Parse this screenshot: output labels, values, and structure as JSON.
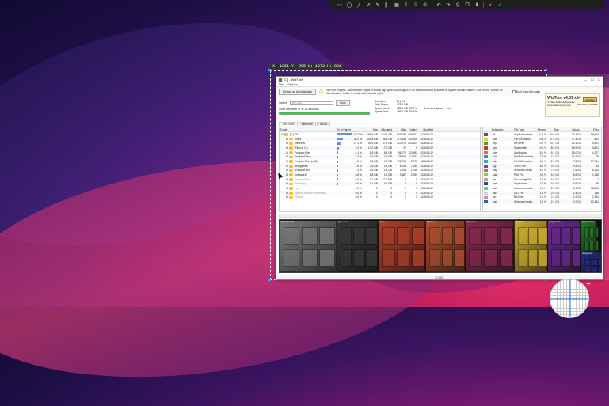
{
  "capture_toolbar": {
    "icons": [
      "rectangle-icon",
      "ellipse-icon",
      "line-icon",
      "arrow-icon",
      "pencil-icon",
      "marker-icon",
      "mosaic-icon",
      "text-icon",
      "sticker-icon",
      "number-icon",
      "undo-icon",
      "redo-icon",
      "pin-icon",
      "copy-icon",
      "save-icon",
      "close-icon",
      "confirm-icon"
    ]
  },
  "selection": {
    "label": "X: 1061 Y: 285 W: 1073 H: 801"
  },
  "window": {
    "title": "[C:] - WizTree",
    "menu": [
      "File",
      "Options"
    ],
    "restart_button": "Restart as Administrator",
    "notice": "WizTree requires \"Administrator\" rights to enable high speed scanning of NTFS hard drives and to access all system files and folders. Click on the \"Restart as Administrator\" button to enable Administrator rights.",
    "dont_show": "Don't show this again",
    "promo": {
      "title": "WizTree v4.31 x64",
      "line1": "© 2026 Antibody Software",
      "line2": "www.diskanalyzer.com",
      "button": "Donate",
      "note": "Click to Go to Donation"
    },
    "select_label": "Select:",
    "drive_value": "(C:) OS",
    "scan_button": "Scan",
    "scan_status": "Scan complete in 42.31 seconds",
    "stats": [
      {
        "k": "Selection:",
        "v": "[C:] OS",
        "k2": "",
        "v2": ""
      },
      {
        "k": "Total Space:",
        "v": "475.2 GB",
        "k2": "",
        "v2": ""
      },
      {
        "k": "Space Used:",
        "v": "188.6 GB (39.7%)",
        "k2": "Reserved Space:",
        "v2": "n/a"
      },
      {
        "k": "Space Free:",
        "v": "286.7 GB (60.3%)",
        "k2": "",
        "v2": ""
      }
    ],
    "tabs": [
      "Tree View",
      "File View",
      "About"
    ],
    "tree_headers": [
      "Folder",
      "% of Parent",
      "Size",
      "Allocated",
      "Files",
      "Folders",
      "Modified"
    ],
    "tree_rows": [
      {
        "name": "[C:] OS",
        "pct": "100.0 %",
        "bar": 1.0,
        "p": "",
        "size": "188.6 GB",
        "alloc": "174.8 GB",
        "files": "805,097",
        "folders": "168,767",
        "mod": "2026/01/12"
      },
      {
        "name": "Users",
        "pct": "38.2 %",
        "bar": 0.38,
        "p": "",
        "size": "104.8 GB",
        "alloc": "88.8 GB",
        "files": "370,994",
        "folders": "102,508",
        "mod": "2026/01/12"
      },
      {
        "name": "Windows",
        "pct": "27.3 %",
        "bar": 0.27,
        "p": "",
        "size": "50.6 GB",
        "alloc": "47.8 GB",
        "files": "323,274",
        "folders": "203,624",
        "mod": "2026/01/12"
      },
      {
        "name": "(Files in C:)",
        "pct": "9.1 %",
        "bar": 0.09,
        "p": "",
        "size": "17.0 GB",
        "alloc": "17.0 GB",
        "files": "27",
        "folders": "0",
        "mod": "2026/01/12"
      },
      {
        "name": "Program Files",
        "pct": "5.1 %",
        "bar": 0.05,
        "p": "",
        "size": "8.8 GB",
        "alloc": "8.8 GB",
        "files": "56,072",
        "folders": "23,982",
        "mod": "2026/01/12"
      },
      {
        "name": "ProgramData",
        "pct": "4.0 %",
        "bar": 0.04,
        "p": "",
        "size": "7.6 GB",
        "alloc": "7.6 GB",
        "files": "28,565",
        "folders": "17,311",
        "mod": "2026/01/12"
      },
      {
        "name": "Program Files (x86)",
        "pct": "4.0 %",
        "bar": 0.04,
        "p": "",
        "size": "7.8 GB",
        "alloc": "7.8 GB",
        "files": "20,793",
        "folders": "2,275",
        "mod": "2026/01/12"
      },
      {
        "name": "xboxgames",
        "pct": "1.6 %",
        "bar": 0.016,
        "p": "",
        "size": "2.9 GB",
        "alloc": "2.4 GB",
        "files": "6,035",
        "folders": "7,280",
        "mod": "2026/01/12"
      },
      {
        "name": "$Recycle.Bin",
        "pct": "1.3 %",
        "bar": 0.013,
        "p": "",
        "size": "2.6 GB",
        "alloc": "2.4 GB",
        "files": "2,194",
        "folders": "1,758",
        "mod": "2026/01/12"
      },
      {
        "name": "SoftwareUI",
        "pct": "0.8 %",
        "bar": 0.008,
        "p": "",
        "size": "1.8 GB",
        "alloc": "1.8 GB",
        "files": "3,687",
        "folders": "2,789",
        "mod": "2026/01/12"
      },
      {
        "name": "ProgramFiles",
        "pct": "0.6 %",
        "bar": 0.006,
        "p": "",
        "size": "1.1 GB",
        "alloc": "27.7 MB",
        "files": "6",
        "folders": "0",
        "mod": "2026/01/12"
      },
      {
        "name": "Recovery",
        "pct": "0.5 %",
        "bar": 0.005,
        "p": "",
        "size": "1.1 GB",
        "alloc": "4.6 GB",
        "files": "0",
        "folders": "0",
        "mod": "2026/01/12"
      },
      {
        "name": "tmp",
        "pct": "0.0 %",
        "bar": 0.0,
        "p": "",
        "size": "0",
        "alloc": "0",
        "files": "0",
        "folders": "0",
        "mod": "2026/01/12"
      },
      {
        "name": "System Volume Information",
        "pct": "0.0 %",
        "bar": 0.0,
        "p": "",
        "size": "0",
        "alloc": "0",
        "files": "0",
        "folders": "0",
        "mod": "2026/01/12"
      },
      {
        "name": "Drivers",
        "pct": "0.0 %",
        "bar": 0.0,
        "p": "",
        "size": "0",
        "alloc": "0",
        "files": "0",
        "folders": "0",
        "mod": "2026/01/12"
      }
    ],
    "ext_headers": [
      "Extension",
      "File Type",
      "Percent",
      "Size",
      "Alloca...",
      "Files"
    ],
    "ext_rows": [
      {
        "color": "#6a3fb0",
        "ext": ".dll",
        "type": "Application exte...",
        "pct": "21.7 %",
        "size": "40.9 GB",
        "alloc": "37.4 GB",
        "files": "86,652"
      },
      {
        "color": "#e0d020",
        "ext": ".exe",
        "type": "File Extension",
        "pct": "19.9 %",
        "size": "37.5 GB",
        "alloc": "37.4 GB",
        "files": "451"
      },
      {
        "color": "#40a040",
        "ext": ".mp4",
        "type": "MP4 File",
        "pct": "10.7 %",
        "size": "20.1 GB",
        "alloc": "20.1 GB",
        "files": "4,621"
      },
      {
        "color": "#d03030",
        "ext": ".sys",
        "type": "System file",
        "pct": "10.1 %",
        "size": "18.9 GB",
        "alloc": "18.9 GB",
        "files": "3,821"
      },
      {
        "color": "#e07020",
        "ext": ".exe",
        "type": "Application",
        "pct": "8.0 %",
        "size": "15.1 GB",
        "alloc": "15.0 GB",
        "files": "4,307"
      },
      {
        "color": "#4080e0",
        "ext": ".wim",
        "type": "WinRAR archive",
        "pct": "7.8 %",
        "size": "14.7 GB",
        "alloc": "14.7 GB",
        "files": "78"
      },
      {
        "color": "#30b0b0",
        "ext": ".cab",
        "type": "WinRAR archive",
        "pct": "6.9 %",
        "size": "12.9 GB",
        "alloc": "7.2 GB",
        "files": "37,121"
      },
      {
        "color": "#b03080",
        "ext": ".jpg",
        "type": "JPEG File",
        "pct": "5.1 %",
        "size": "9.5 GB",
        "alloc": "9.5 GB",
        "files": "44"
      },
      {
        "color": "#808080",
        "ext": ".msp",
        "type": "Windows Install..",
        "pct": "4.0 %",
        "size": "7.6 GB",
        "alloc": "7.6 GB",
        "files": "8,263"
      },
      {
        "color": "#a0c040",
        "ext": ".pak",
        "type": "PAK File",
        "pct": "3.5 %",
        "size": "6.5 GB",
        "alloc": "6.5 GB",
        "files": "1,118"
      },
      {
        "color": "#c0a080",
        "ext": ".iso",
        "type": "Disc Image File",
        "pct": "3.5 %",
        "size": "6.6 GB",
        "alloc": "6.6 GB",
        "files": "2"
      },
      {
        "color": "#2050a0",
        "ext": ".exe",
        "type": "Application",
        "pct": "2.4 %",
        "size": "4.6 GB",
        "alloc": "4.6 GB",
        "files": "30"
      },
      {
        "color": "#60d060",
        "ext": ".msi",
        "type": "Windows Install..",
        "pct": "1.4 %",
        "size": "2.6 GB",
        "alloc": "2.6 GB",
        "files": "78,803"
      },
      {
        "color": "#d0d0d0",
        "ext": ".dat",
        "type": "DAT File",
        "pct": "1.3 %",
        "size": "2.6 GB",
        "alloc": "2.4 GB",
        "files": "148"
      },
      {
        "color": "#f080a0",
        "ext": ".bin",
        "type": "BIN File",
        "pct": "1.2 %",
        "size": "2.2 GB",
        "alloc": "2.2 GB",
        "files": "2,384"
      },
      {
        "color": "#3060c0",
        "ext": ".msi",
        "type": "Windows Install..",
        "pct": "1.2 %",
        "size": "2.2 GB",
        "alloc": "2.2 GB",
        "files": "12,481"
      }
    ],
    "splitter_label": "::::",
    "treemap_blocks": [
      {
        "label": "[C:] 174.8 GB",
        "color": "#7a7a7a"
      },
      {
        "label": "(Files in C:)",
        "color": "#3a3a3a"
      },
      {
        "label": "Users",
        "color": "#b0402a"
      },
      {
        "label": "Windows",
        "color": "#b05030"
      },
      {
        "label": "System32",
        "color": "#8a2a50"
      },
      {
        "label": "WinSxS",
        "color": "#d0b030"
      },
      {
        "label": "Program Files",
        "color": "#6a2a90"
      },
      {
        "label": "ProgramData",
        "color": "#2a7a2a"
      },
      {
        "label": "xboxgames",
        "color": "#2a2a80"
      }
    ],
    "status": "[C:] OS"
  },
  "colors": {
    "progress": "#2ecc40",
    "accent": "#2aa7ff"
  }
}
